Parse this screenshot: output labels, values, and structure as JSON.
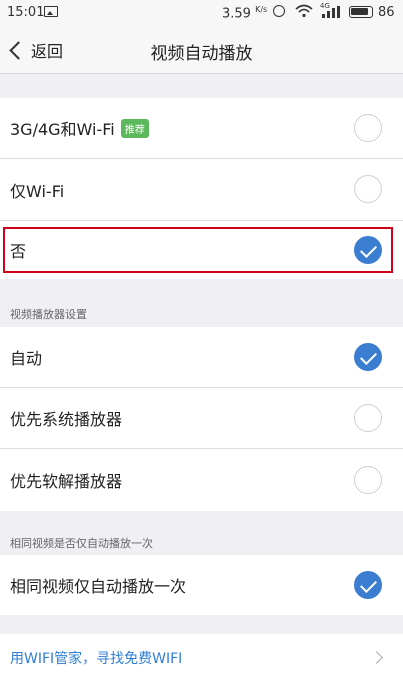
{
  "status_bar": {
    "time": "15:01",
    "speed": "3.59",
    "speed_unit": "K/s",
    "network_label": "4G",
    "battery": "86"
  },
  "nav": {
    "back_label": "返回",
    "title": "视频自动播放"
  },
  "autoplay_options": [
    {
      "label": "3G/4G和Wi-Fi",
      "tag": "推荐",
      "checked": false
    },
    {
      "label": "仅Wi-Fi",
      "checked": false
    },
    {
      "label": "否",
      "checked": true
    }
  ],
  "player_section": {
    "header": "视频播放器设置",
    "options": [
      {
        "label": "自动",
        "checked": true
      },
      {
        "label": "优先系统播放器",
        "checked": false
      },
      {
        "label": "优先软解播放器",
        "checked": false
      }
    ]
  },
  "repeat_section": {
    "header": "相同视频是否仅自动播放一次",
    "option": {
      "label": "相同视频仅自动播放一次",
      "checked": true
    }
  },
  "promo_link": {
    "label": "用WIFI管家，寻找免费WIFI"
  },
  "colors": {
    "accent": "#3b7ed1",
    "highlight_border": "#d0021b",
    "tag_bg": "#5cb85c",
    "link": "#2f7fd6"
  }
}
